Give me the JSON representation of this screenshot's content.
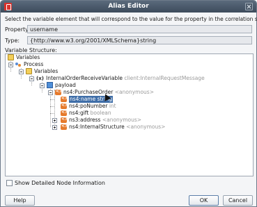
{
  "window": {
    "title": "Alias Editor"
  },
  "instruction": "Select the variable element that will correspond to the value for the property in the correlation set.",
  "property": {
    "label": "Property:",
    "value": "username"
  },
  "type": {
    "label": "Type:",
    "value": "{http://www.w3.org/2001/XMLSchema}string"
  },
  "tree": {
    "label": "Variable Structure:",
    "nodes": {
      "variables_root": "Variables",
      "process": "Process",
      "variables": "Variables",
      "internal_var": "InternalOrderReceiveVariable",
      "internal_var_type": "client:InternalRequestMessage",
      "payload": "payload",
      "purchase_order": "ns4:PurchaseOrder",
      "purchase_order_type": "<anonymous>",
      "name": "ns4:name string",
      "po_number": "ns4:poNumber",
      "po_number_type": "int",
      "gift": "ns4:gift",
      "gift_type": "boolean",
      "address": "ns3:address",
      "address_type": "<anonymous>",
      "internal_structure": "ns4:InternalStructure",
      "internal_structure_type": "<anonymous>"
    }
  },
  "show_detailed": {
    "label": "Show Detailed Node Information",
    "checked": false
  },
  "buttons": {
    "help": "Help",
    "ok": "OK",
    "cancel": "Cancel"
  },
  "colors": {
    "titlebar": "#4a596a",
    "selection": "#3f6ea8",
    "element_icon": "#e67a2c"
  }
}
